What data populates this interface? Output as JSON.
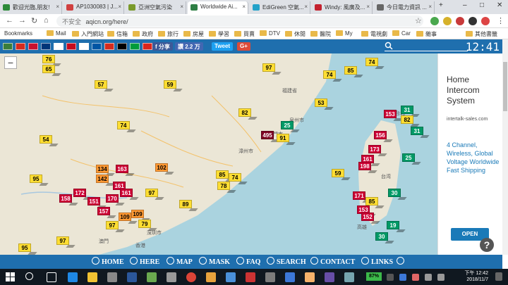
{
  "tabs": [
    {
      "title": "歡迎光臨,朋友!",
      "fav": "#2c8a3a"
    },
    {
      "title": "AP1030083 | J...",
      "fav": "#d04040"
    },
    {
      "title": "亞洲空氣污染",
      "fav": "#7a9a2a"
    },
    {
      "title": "Worldwide Ai...",
      "fav": "#2f7f45"
    },
    {
      "title": "EdiGreen 空氣...",
      "fav": "#23a2c9"
    },
    {
      "title": "Windy: 風廣及...",
      "fav": "#c4222f"
    },
    {
      "title": "今日電力資訊 ...",
      "fav": "#666666"
    }
  ],
  "browser": {
    "url": "aqicn.org/here/",
    "security_label": "不安全",
    "bookmarks": [
      "Bookmarks",
      "Mail",
      "入門網站",
      "信箱",
      "政府",
      "旅行",
      "房屋",
      "學習",
      "買賣",
      "DTV",
      "休閒",
      "醫院",
      "My",
      "電視劇",
      "Car",
      "雜事",
      "其他書籤"
    ]
  },
  "sitebar": {
    "share_label": "f 分享",
    "like_label": "讚 2.2 万",
    "tweet_label": "Tweet",
    "gplus_label": "G+",
    "clock": "12:41",
    "flags": [
      "#3a7d3a",
      "#d52b1e",
      "#c8102e",
      "#003478",
      "#ffffff",
      "#c60b1e",
      "#ffffff",
      "#0055a4",
      "#d52b1e",
      "#000000",
      "#009b3a",
      "#da251d"
    ]
  },
  "map": {
    "zoom_label": "−",
    "labels": [
      "福建省",
      "台北",
      "廈門市",
      "香港",
      "澳門",
      "台湾",
      "泉州市",
      "漳州市",
      "深圳市",
      "高雄"
    ],
    "markers": [
      {
        "v": "76",
        "c": "#ffde33"
      },
      {
        "v": "65",
        "c": "#ffde33"
      },
      {
        "v": "57",
        "c": "#ffde33"
      },
      {
        "v": "59",
        "c": "#ffde33"
      },
      {
        "v": "97",
        "c": "#ffde33"
      },
      {
        "v": "74",
        "c": "#ffde33"
      },
      {
        "v": "85",
        "c": "#ffde33"
      },
      {
        "v": "74",
        "c": "#ffde33"
      },
      {
        "v": "74",
        "c": "#ffde33"
      },
      {
        "v": "54",
        "c": "#ffde33"
      },
      {
        "v": "82",
        "c": "#ffde33"
      },
      {
        "v": "495",
        "c": "#7e0023"
      },
      {
        "v": "25",
        "c": "#009966"
      },
      {
        "v": "53",
        "c": "#ffde33"
      },
      {
        "v": "91",
        "c": "#ffde33"
      },
      {
        "v": "153",
        "c": "#cc0033"
      },
      {
        "v": "31",
        "c": "#009966"
      },
      {
        "v": "82",
        "c": "#ffde33"
      },
      {
        "v": "31",
        "c": "#009966"
      },
      {
        "v": "156",
        "c": "#cc0033"
      },
      {
        "v": "173",
        "c": "#cc0033"
      },
      {
        "v": "161",
        "c": "#cc0033"
      },
      {
        "v": "25",
        "c": "#009966"
      },
      {
        "v": "134",
        "c": "#ff9933"
      },
      {
        "v": "163",
        "c": "#cc0033"
      },
      {
        "v": "102",
        "c": "#ff9933"
      },
      {
        "v": "85",
        "c": "#ffde33"
      },
      {
        "v": "74",
        "c": "#ffde33"
      },
      {
        "v": "78",
        "c": "#ffde33"
      },
      {
        "v": "59",
        "c": "#ffde33"
      },
      {
        "v": "198",
        "c": "#cc0033"
      },
      {
        "v": "95",
        "c": "#ffde33"
      },
      {
        "v": "142",
        "c": "#ff9933"
      },
      {
        "v": "161",
        "c": "#cc0033"
      },
      {
        "v": "172",
        "c": "#cc0033"
      },
      {
        "v": "170",
        "c": "#cc0033"
      },
      {
        "v": "30",
        "c": "#009966"
      },
      {
        "v": "158",
        "c": "#cc0033"
      },
      {
        "v": "151",
        "c": "#cc0033"
      },
      {
        "v": "161",
        "c": "#cc0033"
      },
      {
        "v": "97",
        "c": "#ffde33"
      },
      {
        "v": "171",
        "c": "#cc0033"
      },
      {
        "v": "85",
        "c": "#ffde33"
      },
      {
        "v": "157",
        "c": "#cc0033"
      },
      {
        "v": "109",
        "c": "#ff9933"
      },
      {
        "v": "89",
        "c": "#ffde33"
      },
      {
        "v": "153",
        "c": "#cc0033"
      },
      {
        "v": "152",
        "c": "#cc0033"
      },
      {
        "v": "19",
        "c": "#009966"
      },
      {
        "v": "97",
        "c": "#ffde33"
      },
      {
        "v": "79",
        "c": "#ffde33"
      },
      {
        "v": "97",
        "c": "#ffde33"
      },
      {
        "v": "109",
        "c": "#ff9933"
      },
      {
        "v": "30",
        "c": "#009966"
      },
      {
        "v": "95",
        "c": "#ffde33"
      }
    ]
  },
  "ad": {
    "title": "Home Intercom System",
    "url": "intertalk-sales.com",
    "body": "4 Channel, Wireless, Global Voltage Worldwide Fast Shipping",
    "button": "OPEN"
  },
  "help_label": "?",
  "menu": [
    "HOME",
    "HERE",
    "MAP",
    "MASK",
    "FAQ",
    "SEARCH",
    "CONTACT",
    "LINKS"
  ],
  "taskbar": {
    "battery": "87%",
    "time": "下午 12:42",
    "date": "2018/11/7"
  }
}
